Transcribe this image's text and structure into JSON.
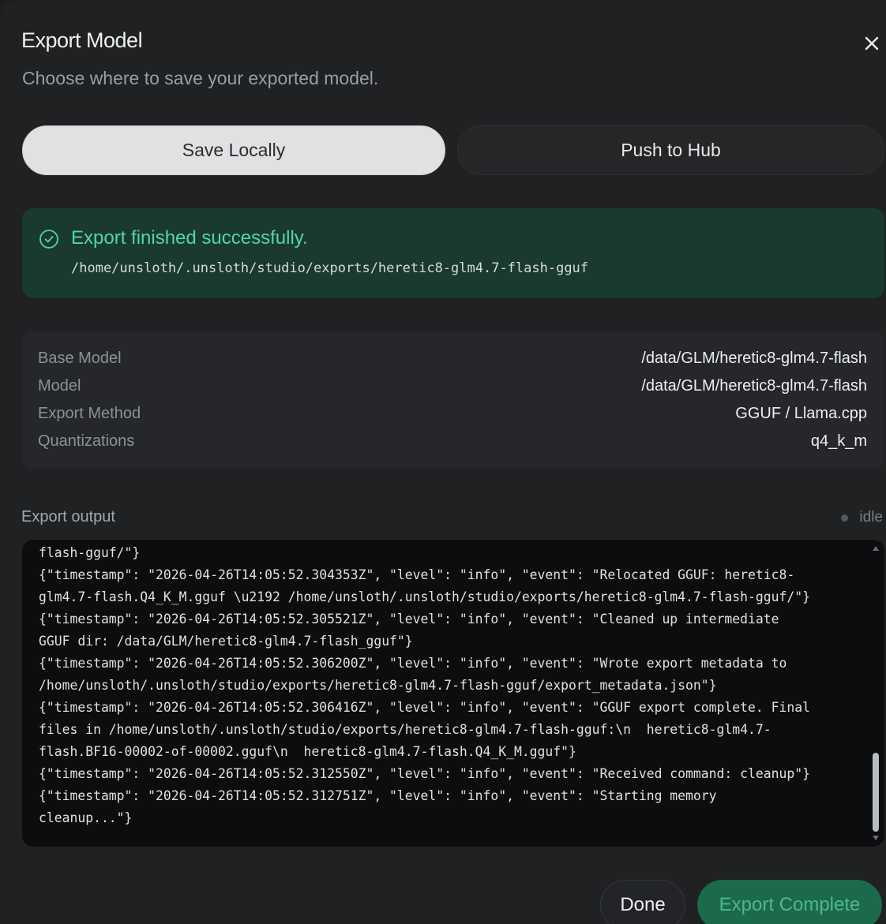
{
  "dialog": {
    "title": "Export Model",
    "subtitle": "Choose where to save your exported model."
  },
  "tabs": {
    "save_locally": "Save Locally",
    "push_to_hub": "Push to Hub",
    "active": "save_locally"
  },
  "success": {
    "title": "Export finished successfully.",
    "path": "/home/unsloth/.unsloth/studio/exports/heretic8-glm4.7-flash-gguf"
  },
  "details": [
    {
      "label": "Base Model",
      "value": "/data/GLM/heretic8-glm4.7-flash"
    },
    {
      "label": "Model",
      "value": "/data/GLM/heretic8-glm4.7-flash"
    },
    {
      "label": "Export Method",
      "value": "GGUF / Llama.cpp"
    },
    {
      "label": "Quantizations",
      "value": "q4_k_m"
    }
  ],
  "output": {
    "label": "Export output",
    "status": "idle",
    "lines": [
      "flash-gguf/\"}",
      "{\"timestamp\": \"2026-04-26T14:05:52.304353Z\", \"level\": \"info\", \"event\": \"Relocated GGUF: heretic8-",
      "glm4.7-flash.Q4_K_M.gguf \\u2192 /home/unsloth/.unsloth/studio/exports/heretic8-glm4.7-flash-gguf/\"}",
      "{\"timestamp\": \"2026-04-26T14:05:52.305521Z\", \"level\": \"info\", \"event\": \"Cleaned up intermediate",
      "GGUF dir: /data/GLM/heretic8-glm4.7-flash_gguf\"}",
      "{\"timestamp\": \"2026-04-26T14:05:52.306200Z\", \"level\": \"info\", \"event\": \"Wrote export metadata to",
      "/home/unsloth/.unsloth/studio/exports/heretic8-glm4.7-flash-gguf/export_metadata.json\"}",
      "{\"timestamp\": \"2026-04-26T14:05:52.306416Z\", \"level\": \"info\", \"event\": \"GGUF export complete. Final",
      "files in /home/unsloth/.unsloth/studio/exports/heretic8-glm4.7-flash-gguf:\\n  heretic8-glm4.7-",
      "flash.BF16-00002-of-00002.gguf\\n  heretic8-glm4.7-flash.Q4_K_M.gguf\"}",
      "{\"timestamp\": \"2026-04-26T14:05:52.312550Z\", \"level\": \"info\", \"event\": \"Received command: cleanup\"}",
      "{\"timestamp\": \"2026-04-26T14:05:52.312751Z\", \"level\": \"info\", \"event\": \"Starting memory",
      "cleanup...\"}"
    ]
  },
  "footer": {
    "done": "Done",
    "export_complete": "Export Complete"
  },
  "icons": {
    "close": "close-icon",
    "success": "check-circle-icon"
  },
  "colors": {
    "success_text": "#4fd89e",
    "success_bg": "#1a3a30",
    "export_button_bg": "#1c6a4c"
  }
}
